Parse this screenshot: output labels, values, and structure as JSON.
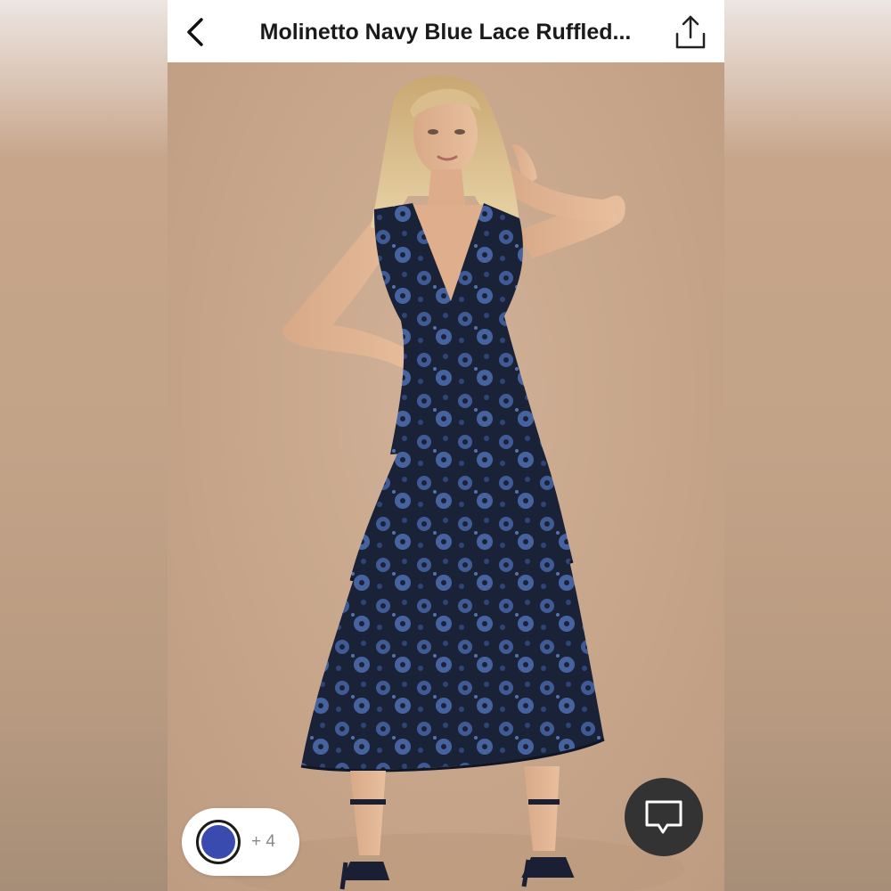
{
  "header": {
    "title": "Molinetto Navy Blue Lace Ruffled...",
    "back_icon": "chevron-left-icon",
    "share_icon": "share-upload-icon"
  },
  "product_image": {
    "description_icon": "product-photo"
  },
  "color_selector": {
    "selected_color": "#3a4bb0",
    "more_count": "+ 4"
  },
  "chat_button": {
    "icon": "chat-bubble-icon"
  },
  "colors": {
    "header_bg": "#ffffff",
    "backdrop": "#c8a68a",
    "chat_bg": "#333333"
  }
}
